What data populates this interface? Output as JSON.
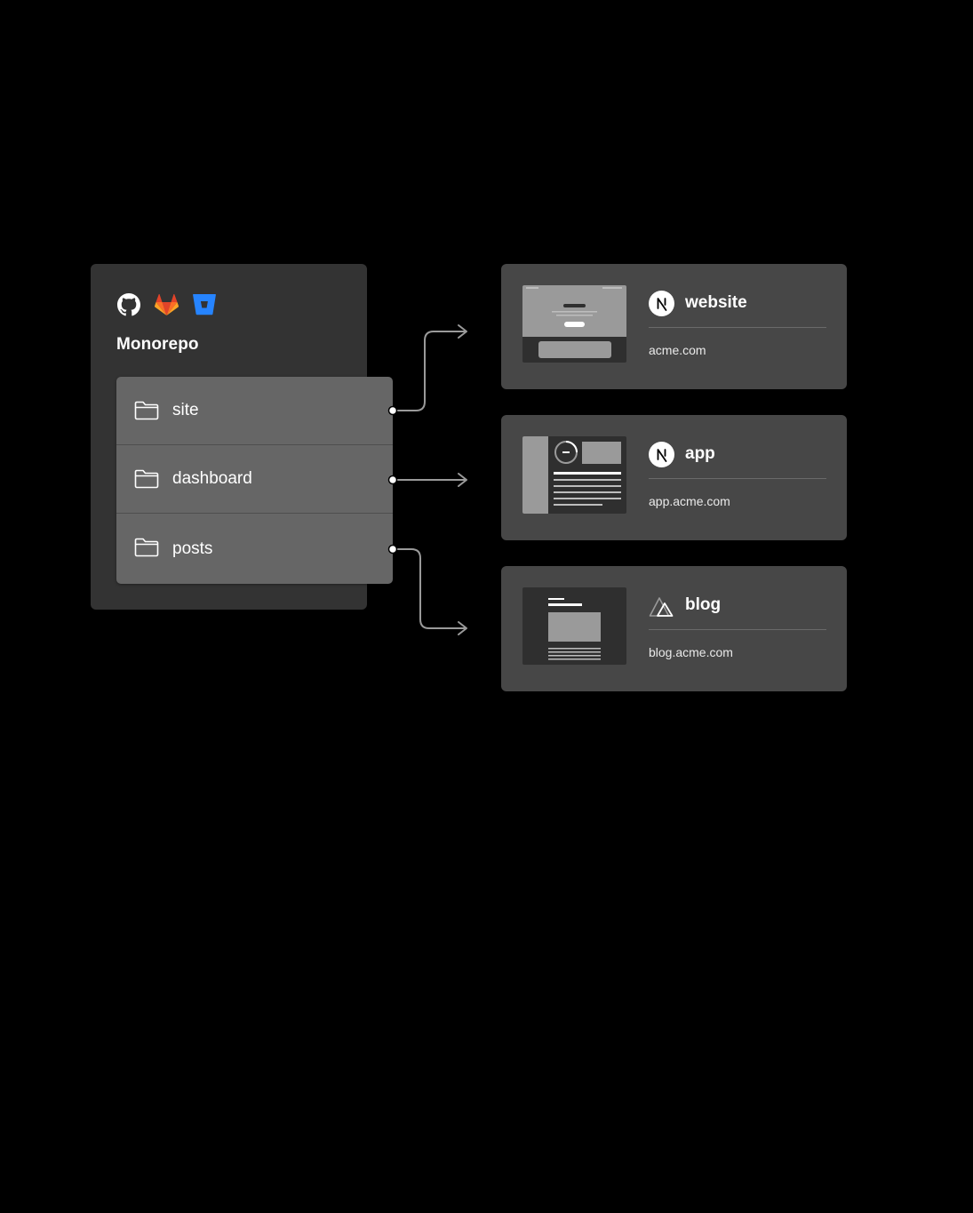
{
  "repo": {
    "title": "Monorepo",
    "providers": [
      {
        "icon": "github-icon",
        "color": "#ffffff"
      },
      {
        "icon": "gitlab-icon",
        "color": "#fc6d26"
      },
      {
        "icon": "bitbucket-icon",
        "color": "#2684ff"
      }
    ],
    "folders": [
      {
        "label": "site",
        "icon": "folder-icon"
      },
      {
        "label": "dashboard",
        "icon": "folder-icon"
      },
      {
        "label": "posts",
        "icon": "folder-icon"
      }
    ]
  },
  "projects": [
    {
      "name": "website",
      "domain": "acme.com",
      "framework_icon": "nextjs-icon"
    },
    {
      "name": "app",
      "domain": "app.acme.com",
      "framework_icon": "nextjs-icon"
    },
    {
      "name": "blog",
      "domain": "blog.acme.com",
      "framework_icon": "nuxt-icon"
    }
  ],
  "colors": {
    "background": "#000000",
    "panel": "#333333",
    "folder_list": "#666666",
    "card": "#474747",
    "connector": "#9a9a9a"
  }
}
